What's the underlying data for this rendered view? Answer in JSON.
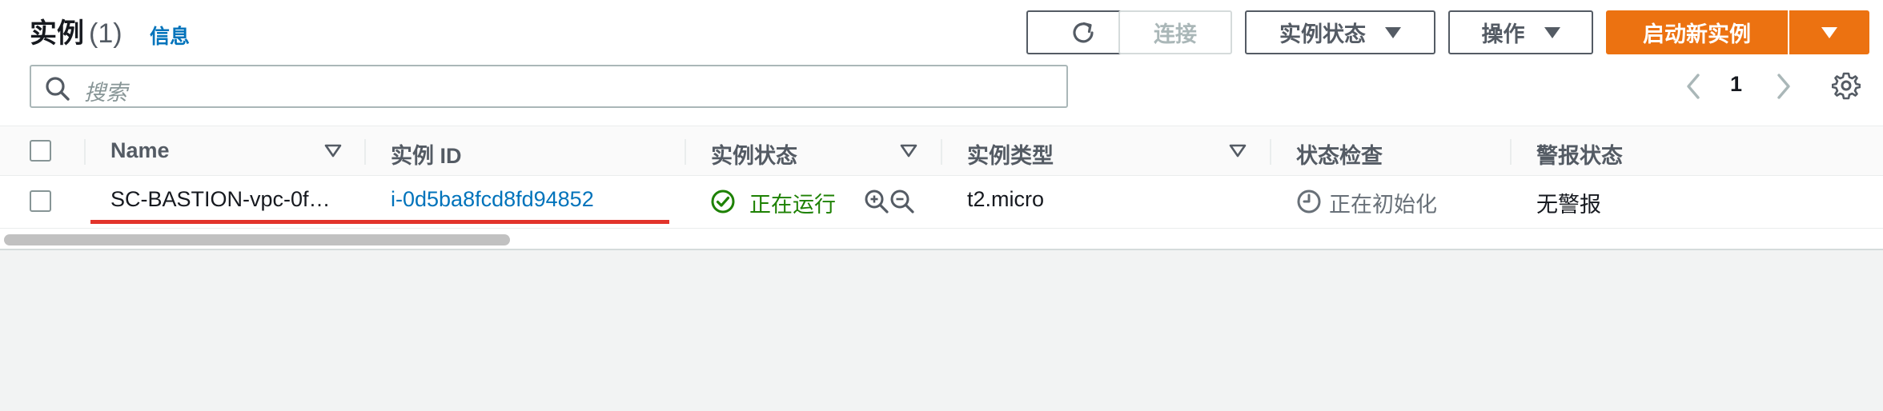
{
  "header": {
    "title": "实例",
    "count": "(1)",
    "info_link": "信息"
  },
  "toolbar": {
    "connect_label": "连接",
    "instance_state_label": "实例状态",
    "actions_label": "操作",
    "launch_label": "启动新实例"
  },
  "search": {
    "placeholder": "搜索"
  },
  "pagination": {
    "current_page": "1"
  },
  "table": {
    "columns": [
      "Name",
      "实例 ID",
      "实例状态",
      "实例类型",
      "状态检查",
      "警报状态"
    ],
    "rows": [
      {
        "name": "SC-BASTION-vpc-0f…",
        "instance_id": "i-0d5ba8fcd8fd94852",
        "state": "正在运行",
        "type": "t2.micro",
        "status_check": "正在初始化",
        "alarm": "无警报"
      }
    ]
  },
  "colors": {
    "primary": "#ec7211",
    "link": "#0073bb",
    "running": "#1d8102",
    "highlight": "#e2342b"
  }
}
